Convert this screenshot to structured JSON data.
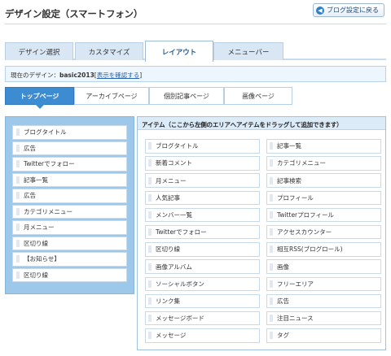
{
  "header": {
    "title": "デザイン設定（スマートフォン）",
    "back_label": "ブログ設定に戻る"
  },
  "main_tabs": [
    {
      "label": "デザイン選択"
    },
    {
      "label": "カスタマイズ"
    },
    {
      "label": "レイアウト",
      "active": true
    },
    {
      "label": "メニューバー"
    }
  ],
  "design_bar": {
    "prefix": "現在のデザイン：",
    "name": "basic2013",
    "bracket_open": "[",
    "link": "表示を確認する",
    "bracket_close": "]"
  },
  "sub_tabs": [
    {
      "label": "トップページ",
      "active": true
    },
    {
      "label": "アーカイブページ"
    },
    {
      "label": "個別記事ページ"
    },
    {
      "label": "画像ページ"
    }
  ],
  "left_items": [
    "ブログタイトル",
    "広告",
    "Twitterでフォロー",
    "記事一覧",
    "広告",
    "カテゴリメニュー",
    "月メニュー",
    "区切り線",
    "【お知らせ】",
    "区切り線"
  ],
  "right_panel": {
    "heading": "アイテム（ここから左側のエリアへアイテムをドラッグして追加できます）",
    "items": [
      "ブログタイトル",
      "記事一覧",
      "新着コメント",
      "カテゴリメニュー",
      "月メニュー",
      "記事検索",
      "人気記事",
      "プロフィール",
      "メンバー一覧",
      "Twitterプロフィール",
      "Twitterでフォロー",
      "アクセスカウンター",
      "区切り線",
      "相互RSS(ブログロール)",
      "画像アルバム",
      "画像",
      "ソーシャルボタン",
      "フリーエリア",
      "リンク集",
      "広告",
      "メッセージボード",
      "注目ニュース",
      "メッセージ",
      "タグ"
    ]
  }
}
